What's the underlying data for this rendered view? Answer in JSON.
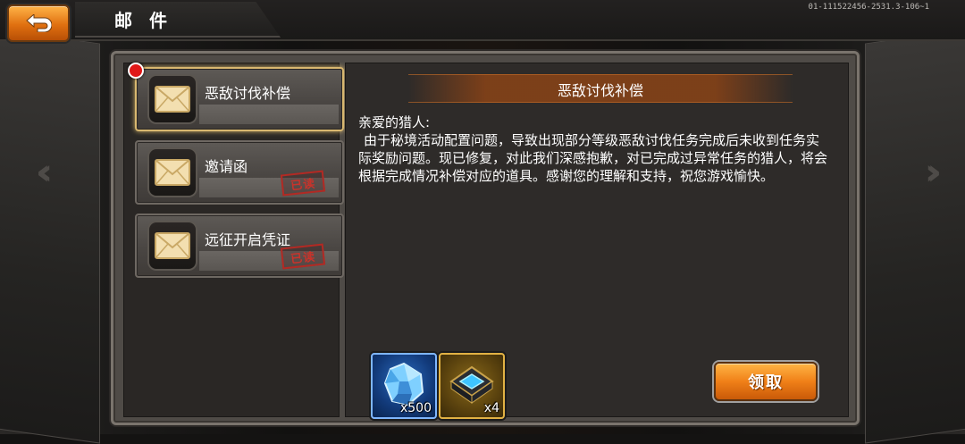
{
  "header": {
    "title": "邮 件",
    "version": "01-111522456-2531.3-106~1",
    "back_icon": "return-arrow-icon"
  },
  "mail_list": [
    {
      "label": "恶敌讨伐补偿",
      "status": "unread",
      "selected": true
    },
    {
      "label": "邀请函",
      "status": "已读",
      "selected": false
    },
    {
      "label": "远征开启凭证",
      "status": "已读",
      "selected": false
    }
  ],
  "mail": {
    "title": "恶敌讨伐补偿",
    "greeting": "亲爱的猎人:",
    "body": "由于秘境活动配置问题，导致出现部分等级恶敌讨伐任务完成后未收到任务实际奖励问题。现已修复，对此我们深感抱歉，对已完成过异常任务的猎人，将会根据完成情况补偿对应的道具。感谢您的理解和支持，祝您游戏愉快。",
    "rewards": [
      {
        "icon": "blue-gem-icon",
        "quantity": "x500"
      },
      {
        "icon": "circuit-chip-icon",
        "quantity": "x4"
      }
    ],
    "claim_label": "领取"
  },
  "colors": {
    "accent_orange": "#f08018",
    "unread_dot": "#e01818",
    "stamp_red": "#c8332b",
    "selected_border": "#d9b870"
  }
}
